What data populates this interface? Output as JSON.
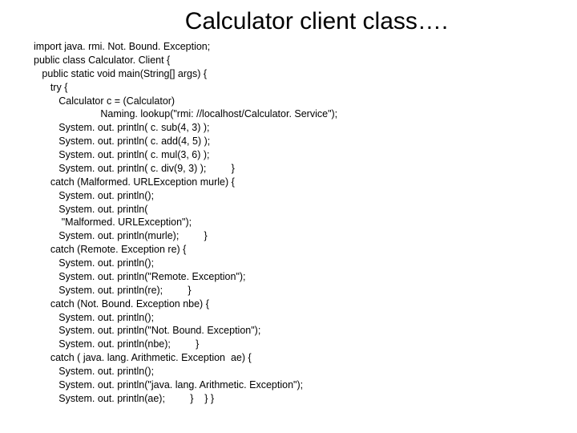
{
  "title": "Calculator client class….",
  "code_lines": [
    "import java. rmi. Not. Bound. Exception;",
    "public class Calculator. Client {",
    "   public static void main(String[] args) {",
    "      try {",
    "         Calculator c = (Calculator)",
    "                        Naming. lookup(\"rmi: //localhost/Calculator. Service\");",
    "         System. out. println( c. sub(4, 3) );",
    "         System. out. println( c. add(4, 5) );",
    "         System. out. println( c. mul(3, 6) );",
    "         System. out. println( c. div(9, 3) );         }",
    "      catch (Malformed. URLException murle) {",
    "         System. out. println();",
    "         System. out. println(",
    "          \"Malformed. URLException\");",
    "         System. out. println(murle);         }",
    "      catch (Remote. Exception re) {",
    "         System. out. println();",
    "         System. out. println(\"Remote. Exception\");",
    "         System. out. println(re);         }",
    "      catch (Not. Bound. Exception nbe) {",
    "         System. out. println();",
    "         System. out. println(\"Not. Bound. Exception\");",
    "         System. out. println(nbe);         }",
    "      catch ( java. lang. Arithmetic. Exception  ae) {",
    "         System. out. println();",
    "         System. out. println(\"java. lang. Arithmetic. Exception\");",
    "         System. out. println(ae);         }    } }"
  ]
}
